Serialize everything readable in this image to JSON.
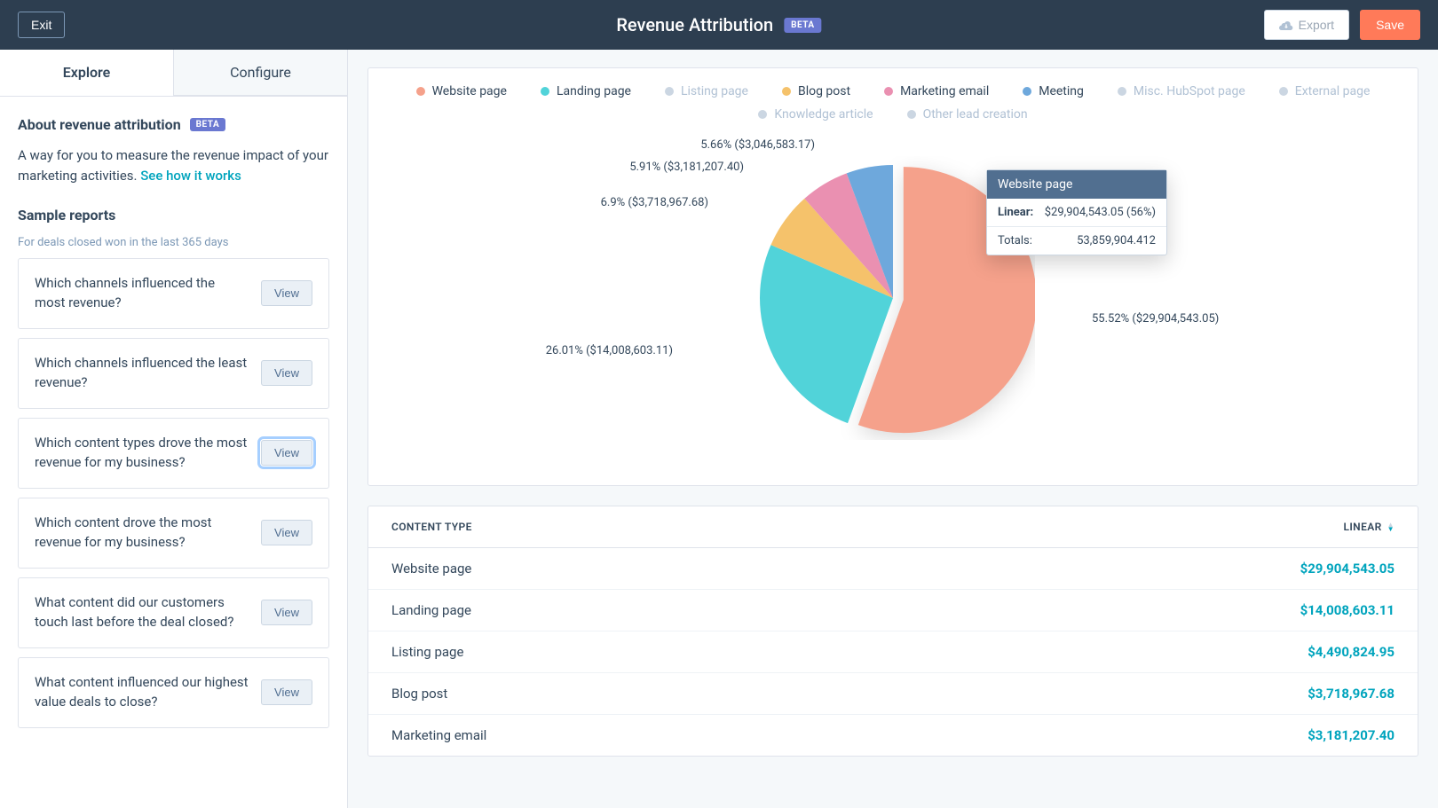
{
  "header": {
    "exit_label": "Exit",
    "title": "Revenue Attribution",
    "beta_label": "BETA",
    "export_label": "Export",
    "save_label": "Save"
  },
  "tabs": {
    "explore": "Explore",
    "configure": "Configure"
  },
  "about": {
    "heading": "About revenue attribution",
    "beta_label": "BETA",
    "description": "A way for you to measure the revenue impact of your marketing activities. ",
    "link_label": "See how it works"
  },
  "sample": {
    "heading": "Sample reports",
    "subheading": "For deals closed won in the last 365 days",
    "view_label": "View",
    "reports": [
      "Which channels influenced the most revenue?",
      "Which channels influenced the least revenue?",
      "Which content types drove the most revenue for my business?",
      "Which content drove the most revenue for my business?",
      "What content did our customers touch last before the deal closed?",
      "What content influenced our highest value deals to close?"
    ],
    "focused_index": 2
  },
  "legend": [
    {
      "label": "Website page",
      "color": "#f5a18b",
      "dim": false
    },
    {
      "label": "Landing page",
      "color": "#51d3d9",
      "dim": false
    },
    {
      "label": "Listing page",
      "color": "#cbd6e2",
      "dim": true
    },
    {
      "label": "Blog post",
      "color": "#f5c26b",
      "dim": false
    },
    {
      "label": "Marketing email",
      "color": "#ea90b1",
      "dim": false
    },
    {
      "label": "Meeting",
      "color": "#6ea8dc",
      "dim": false
    },
    {
      "label": "Misc. HubSpot page",
      "color": "#cbd6e2",
      "dim": true
    },
    {
      "label": "External page",
      "color": "#cbd6e2",
      "dim": true
    },
    {
      "label": "Knowledge article",
      "color": "#cbd6e2",
      "dim": true
    },
    {
      "label": "Other lead creation",
      "color": "#cbd6e2",
      "dim": true
    }
  ],
  "chart_data": {
    "type": "pie",
    "title": "",
    "series": [
      {
        "name": "Website page",
        "percent": 55.52,
        "value": 29904543.05,
        "label": "55.52% ($29,904,543.05)",
        "color": "#f5a18b"
      },
      {
        "name": "Landing page",
        "percent": 26.01,
        "value": 14008603.11,
        "label": "26.01% ($14,008,603.11)",
        "color": "#51d3d9"
      },
      {
        "name": "Blog post",
        "percent": 6.9,
        "value": 3718967.68,
        "label": "6.9% ($3,718,967.68)",
        "color": "#f5c26b"
      },
      {
        "name": "Marketing email",
        "percent": 5.91,
        "value": 3181207.4,
        "label": "5.91% ($3,181,207.40)",
        "color": "#ea90b1"
      },
      {
        "name": "Meeting",
        "percent": 5.66,
        "value": 3046583.17,
        "label": "5.66% ($3,046,583.17)",
        "color": "#6ea8dc"
      }
    ],
    "popped_index": 0
  },
  "tooltip": {
    "title": "Website page",
    "linear_label": "Linear:",
    "linear_value": "$29,904,543.05 (56%)",
    "totals_label": "Totals:",
    "totals_value": "53,859,904.412"
  },
  "table": {
    "col_content": "CONTENT TYPE",
    "col_linear": "LINEAR",
    "rows": [
      {
        "name": "Website page",
        "value": "$29,904,543.05"
      },
      {
        "name": "Landing page",
        "value": "$14,008,603.11"
      },
      {
        "name": "Listing page",
        "value": "$4,490,824.95"
      },
      {
        "name": "Blog post",
        "value": "$3,718,967.68"
      },
      {
        "name": "Marketing email",
        "value": "$3,181,207.40"
      }
    ]
  }
}
